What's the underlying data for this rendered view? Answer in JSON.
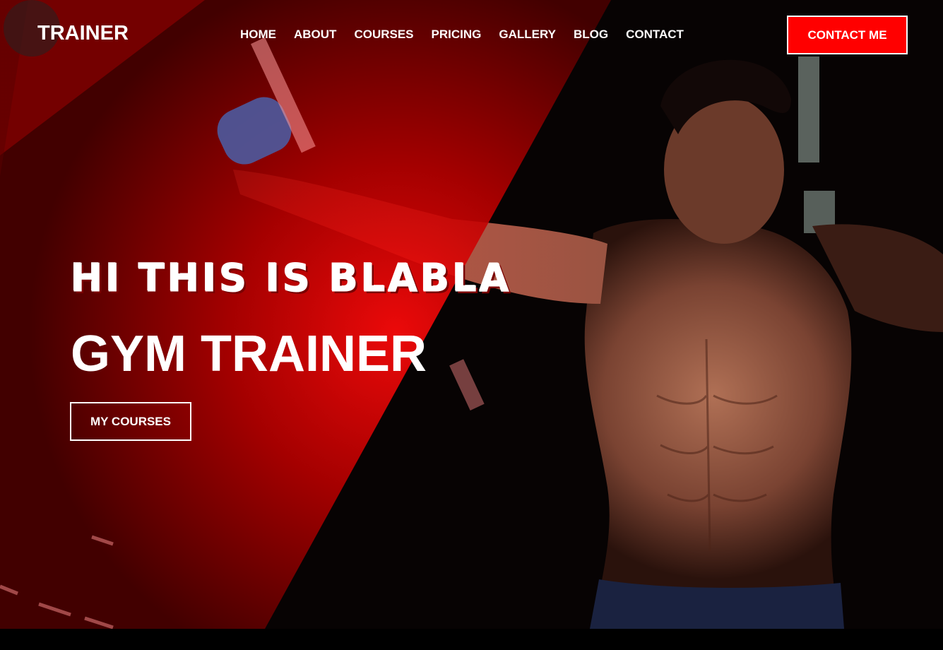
{
  "brand": {
    "logo": "TRAINER"
  },
  "nav": {
    "items": [
      "HOME",
      "ABOUT",
      "COURSES",
      "PRICING",
      "GALLERY",
      "BLOG",
      "CONTACT"
    ]
  },
  "header": {
    "cta_label": "CONTACT ME"
  },
  "hero": {
    "greeting": "HI THIS IS BLABLA",
    "title": "GYM TRAINER",
    "button_label": "MY COURSES"
  },
  "colors": {
    "accent": "#ff0000",
    "overlay_red": "#c00000",
    "background": "#000000",
    "text": "#ffffff"
  },
  "media": {
    "hero_image": "muscular-man-training-cable-machine"
  }
}
